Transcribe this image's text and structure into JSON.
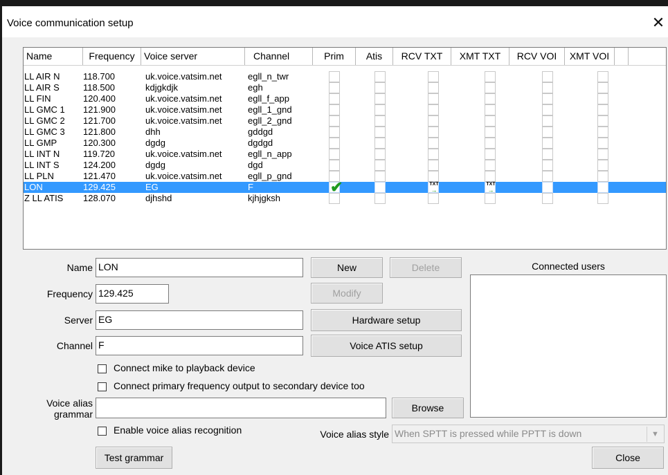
{
  "window": {
    "title": "Voice communication setup",
    "close_glyph": "✕"
  },
  "columns": [
    "Name",
    "Frequency",
    "Voice server",
    "Channel",
    "Prim",
    "Atis",
    "RCV TXT",
    "XMT TXT",
    "RCV VOI",
    "XMT VOI"
  ],
  "rows": [
    {
      "name": "LL AIR N",
      "frequency": "118.700",
      "server": "uk.voice.vatsim.net",
      "channel": "egll_n_twr",
      "selected": false,
      "prim": false,
      "rcv_txt": false,
      "xmt_txt": false
    },
    {
      "name": "LL AIR S",
      "frequency": "118.500",
      "server": "kdjgkdjk",
      "channel": "egh",
      "selected": false,
      "prim": false,
      "rcv_txt": false,
      "xmt_txt": false
    },
    {
      "name": "LL FIN",
      "frequency": "120.400",
      "server": "uk.voice.vatsim.net",
      "channel": "egll_f_app",
      "selected": false,
      "prim": false,
      "rcv_txt": false,
      "xmt_txt": false
    },
    {
      "name": "LL GMC 1",
      "frequency": "121.900",
      "server": "uk.voice.vatsim.net",
      "channel": "egll_1_gnd",
      "selected": false,
      "prim": false,
      "rcv_txt": false,
      "xmt_txt": false
    },
    {
      "name": "LL GMC 2",
      "frequency": "121.700",
      "server": "uk.voice.vatsim.net",
      "channel": "egll_2_gnd",
      "selected": false,
      "prim": false,
      "rcv_txt": false,
      "xmt_txt": false
    },
    {
      "name": "LL GMC 3",
      "frequency": "121.800",
      "server": "dhh",
      "channel": "gddgd",
      "selected": false,
      "prim": false,
      "rcv_txt": false,
      "xmt_txt": false
    },
    {
      "name": "LL GMP",
      "frequency": "120.300",
      "server": "dgdg",
      "channel": "dgdgd",
      "selected": false,
      "prim": false,
      "rcv_txt": false,
      "xmt_txt": false
    },
    {
      "name": "LL INT N",
      "frequency": "119.720",
      "server": "uk.voice.vatsim.net",
      "channel": "egll_n_app",
      "selected": false,
      "prim": false,
      "rcv_txt": false,
      "xmt_txt": false
    },
    {
      "name": "LL INT S",
      "frequency": "124.200",
      "server": "dgdg",
      "channel": "dgd",
      "selected": false,
      "prim": false,
      "rcv_txt": false,
      "xmt_txt": false
    },
    {
      "name": "LL PLN",
      "frequency": "121.470",
      "server": "uk.voice.vatsim.net",
      "channel": "egll_p_gnd",
      "selected": false,
      "prim": false,
      "rcv_txt": false,
      "xmt_txt": false
    },
    {
      "name": "LON",
      "frequency": "129.425",
      "server": "EG",
      "channel": "F",
      "selected": true,
      "prim": true,
      "rcv_txt": true,
      "xmt_txt": true
    },
    {
      "name": "Z LL ATIS",
      "frequency": "128.070",
      "server": "djhshd",
      "channel": "kjhjgksh",
      "selected": false,
      "prim": false,
      "rcv_txt": false,
      "xmt_txt": false
    }
  ],
  "icons": {
    "prim_check": "check-icon",
    "txt_toggle": "txt-arrow-icon",
    "check_glyph": "✔",
    "txt_label": "TXT",
    "txt_arrow": "→"
  },
  "colors": {
    "selection": "#3399ff",
    "check": "#1f9a1f"
  },
  "form": {
    "name_label": "Name",
    "name_value": "LON",
    "frequency_label": "Frequency",
    "frequency_value": "129.425",
    "server_label": "Server",
    "server_value": "EG",
    "channel_label": "Channel",
    "channel_value": "F",
    "connect_mike_label": "Connect mike to playback device",
    "connect_primary_label": "Connect primary frequency output to secondary device too",
    "voice_alias_label_1": "Voice alias",
    "voice_alias_label_2": "grammar",
    "voice_alias_value": "",
    "enable_alias_label": "Enable voice alias recognition",
    "alias_style_label": "Voice alias style",
    "alias_style_value": "When SPTT is pressed while PPTT is down"
  },
  "buttons": {
    "new": "New",
    "delete": "Delete",
    "modify": "Modify",
    "hardware_setup": "Hardware setup",
    "voice_atis_setup": "Voice ATIS setup",
    "browse": "Browse",
    "test_grammar": "Test grammar",
    "close": "Close"
  },
  "connected_users": {
    "title": "Connected users",
    "users": []
  }
}
